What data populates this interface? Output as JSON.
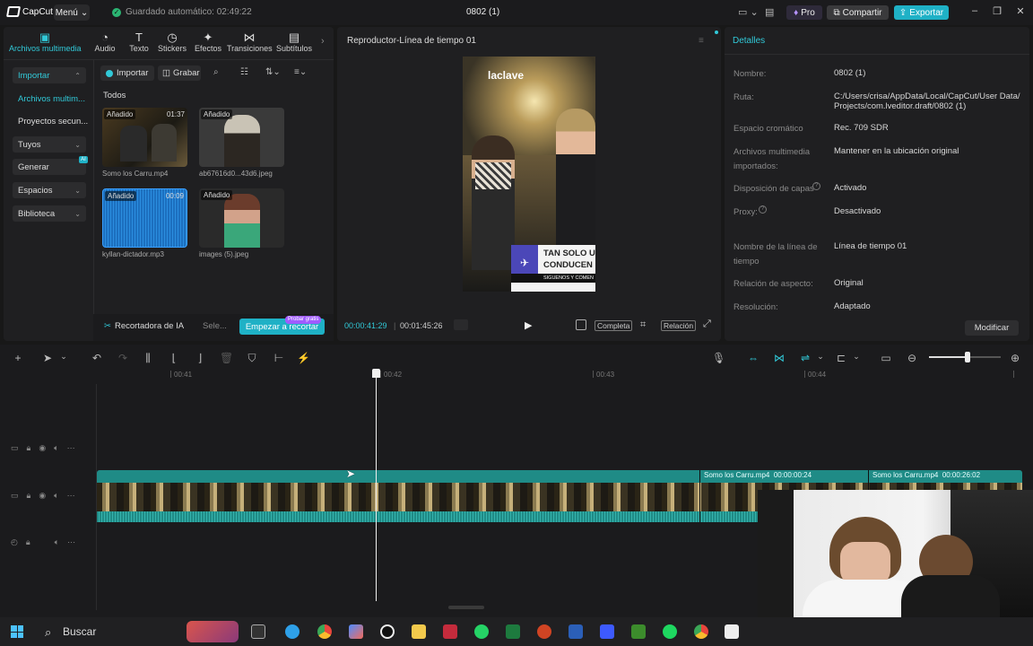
{
  "app": {
    "name": "CapCut",
    "menu_label": "Menú",
    "autosave": "Guardado automático: 02:49:22",
    "title": "0802 (1)",
    "pro_label": "Pro",
    "share_label": "Compartir",
    "export_label": "Exportar"
  },
  "toolbar_tabs": [
    {
      "label": "Archivos multimedia",
      "icon": "media-icon",
      "glyph": "▣"
    },
    {
      "label": "Audio",
      "icon": "audio-icon",
      "glyph": "◔"
    },
    {
      "label": "Texto",
      "icon": "text-icon",
      "glyph": "T"
    },
    {
      "label": "Stickers",
      "icon": "sticker-icon",
      "glyph": "◷"
    },
    {
      "label": "Efectos",
      "icon": "effects-icon",
      "glyph": "✦"
    },
    {
      "label": "Transiciones",
      "icon": "transitions-icon",
      "glyph": "⋈"
    },
    {
      "label": "Subtítulos",
      "icon": "subtitles-icon",
      "glyph": "▤"
    }
  ],
  "sidebar": [
    {
      "label": "Importar",
      "has_chev": true
    },
    {
      "label": "Archivos multim...",
      "has_chev": false
    },
    {
      "label": "Proyectos secun...",
      "has_chev": false
    },
    {
      "label": "Tuyos",
      "has_chev": true
    },
    {
      "label": "Generar",
      "has_chev": false
    },
    {
      "label": "Espacios",
      "has_chev": true
    },
    {
      "label": "Biblioteca",
      "has_chev": true
    }
  ],
  "media": {
    "import_label": "Importar",
    "record_label": "Grabar",
    "all_label": "Todos",
    "items": [
      {
        "badge": "Añadido",
        "duration": "01:37",
        "name": "Somo los Carru.mp4"
      },
      {
        "badge": "Añadido",
        "duration": "",
        "name": "ab67616d0...43d6.jpeg"
      },
      {
        "badge": "Añadido",
        "duration": "00:09",
        "name": "kyllan-dictador.mp3"
      },
      {
        "badge": "Añadido",
        "duration": "",
        "name": "images (5).jpeg"
      }
    ],
    "ai_cut_label": "Recortadora de IA",
    "select_label": "Sele...",
    "start_cut_label": "Empezar a recortar",
    "try_free_label": "Probar gratis"
  },
  "player": {
    "title": "Reproductor-Línea de tiempo 01",
    "current_time": "00:00:41:29",
    "total_time": "00:01:45:26",
    "complete_label": "Completa",
    "ratio_label": "Relación",
    "video_logo": "laclave",
    "overlay_line1": "TAN SOLO U",
    "overlay_line2": "CONDUCEN",
    "overlay_line3": "SIGUENOS Y COMEN"
  },
  "details": {
    "title": "Detalles",
    "rows": [
      {
        "label": "Nombre:",
        "value": "0802 (1)"
      },
      {
        "label": "Ruta:",
        "value": "C:/Users/crisa/AppData/Local/CapCut/User Data/ Projects/com.lveditor.draft/0802 (1)"
      },
      {
        "label": "Espacio cromático",
        "value": "Rec. 709 SDR"
      },
      {
        "label": "Archivos multimedia importados:",
        "value": "Mantener en la ubicación original"
      },
      {
        "label": "Disposición de capas",
        "value": "Activado"
      },
      {
        "label": "Proxy:",
        "value": "Desactivado"
      },
      {
        "label": "Nombre de la línea de tiempo",
        "value": "Línea de tiempo 01"
      },
      {
        "label": "Relación de aspecto:",
        "value": "Original"
      },
      {
        "label": "Resolución:",
        "value": "Adaptado"
      }
    ],
    "modify_label": "Modificar"
  },
  "timeline": {
    "ticks": [
      "00:41",
      "00:42",
      "00:43",
      "00:44"
    ],
    "clips": [
      {
        "name": "Somo los Carru.mp4",
        "time": "00:00:00:24"
      },
      {
        "name": "Somo los Carru.mp4",
        "time": "00:00:26:02"
      }
    ]
  },
  "taskbar": {
    "search_label": "Buscar"
  },
  "colors": {
    "accent": "#1fb1c6",
    "track": "#1f8b86"
  }
}
